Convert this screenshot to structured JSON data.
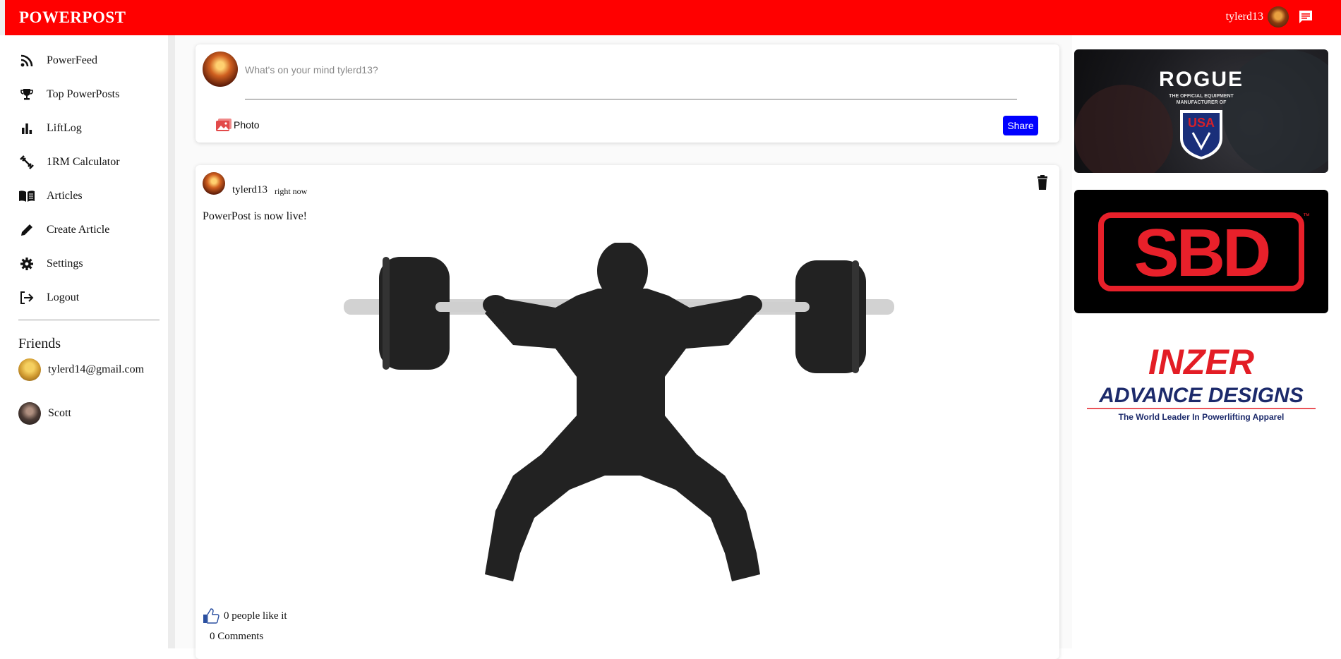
{
  "app": {
    "brand": "POWERPOST"
  },
  "topbar": {
    "username": "tylerd13",
    "message_icon": "chat-icon"
  },
  "sidebar": {
    "items": [
      {
        "label": "PowerFeed",
        "icon": "rss-icon"
      },
      {
        "label": "Top PowerPosts",
        "icon": "trophy-icon"
      },
      {
        "label": "LiftLog",
        "icon": "bar-chart-icon"
      },
      {
        "label": "1RM Calculator",
        "icon": "dumbbell-icon"
      },
      {
        "label": "Articles",
        "icon": "book-icon"
      },
      {
        "label": "Create Article",
        "icon": "pencil-icon"
      },
      {
        "label": "Settings",
        "icon": "gear-icon"
      },
      {
        "label": "Logout",
        "icon": "logout-icon"
      }
    ],
    "friends_title": "Friends",
    "friends": [
      {
        "name": "tylerd14@gmail.com"
      },
      {
        "name": "Scott"
      }
    ]
  },
  "composer": {
    "placeholder": "What's on your mind tylerd13?",
    "value": "",
    "photo_label": "Photo",
    "share_label": "Share"
  },
  "post": {
    "username": "tylerd13",
    "time": "right now",
    "text": "PowerPost is now live!",
    "likes_label": "0 people like it",
    "comments_label": "0 Comments"
  },
  "ads": {
    "rogue": {
      "brand": "ROGUE",
      "line1": "THE OFFICIAL EQUIPMENT",
      "line2": "MANUFACTURER OF",
      "badge": "USA"
    },
    "sbd": {
      "brand": "SBD",
      "tm": "™"
    },
    "inzer": {
      "brand": "INZER",
      "sub": "ADVANCE DESIGNS",
      "tagline": "The World Leader In Powerlifting Apparel"
    }
  },
  "colors": {
    "topbar": "#ff0000",
    "share": "#0000ff",
    "like": "#2a4fa0"
  }
}
